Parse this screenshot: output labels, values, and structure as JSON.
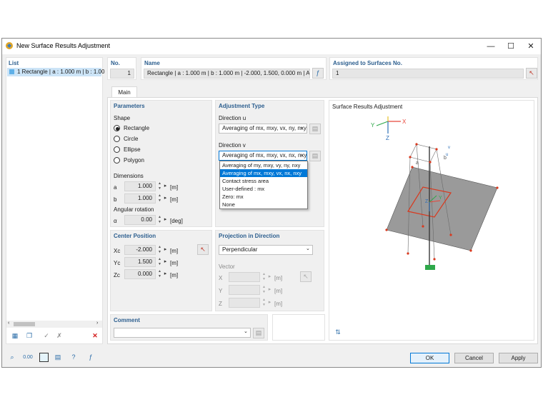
{
  "window": {
    "title": "New Surface Results Adjustment"
  },
  "list": {
    "header": "List",
    "items": [
      {
        "label": "1  Rectangle | a : 1.000 m | b : 1.00"
      }
    ]
  },
  "no": {
    "label": "No.",
    "value": "1"
  },
  "name": {
    "label": "Name",
    "value": "Rectangle | a : 1.000 m | b : 1.000 m | -2.000, 1.500, 0.000 m | Avera"
  },
  "assigned": {
    "label": "Assigned to Surfaces No.",
    "value": "1"
  },
  "tabs": {
    "main": "Main"
  },
  "parameters": {
    "header": "Parameters",
    "shape_label": "Shape",
    "shapes": [
      "Rectangle",
      "Circle",
      "Ellipse",
      "Polygon"
    ],
    "selected_shape": "Rectangle",
    "dimensions_label": "Dimensions",
    "a": {
      "label": "a",
      "value": "1.000",
      "unit": "[m]"
    },
    "b": {
      "label": "b",
      "value": "1.000",
      "unit": "[m]"
    },
    "angular_label": "Angular rotation",
    "alpha": {
      "label": "α",
      "value": "0.00",
      "unit": "[deg]"
    }
  },
  "center": {
    "header": "Center Position",
    "xc": {
      "label": "Xc",
      "value": "-2.000",
      "unit": "[m]"
    },
    "yc": {
      "label": "Yc",
      "value": "1.500",
      "unit": "[m]"
    },
    "zc": {
      "label": "Zc",
      "value": "0.000",
      "unit": "[m]"
    }
  },
  "adjustment": {
    "header": "Adjustment Type",
    "u_label": "Direction u",
    "u_value": "Averaging of mx, mxy, vx, ny, nxy",
    "v_label": "Direction v",
    "v_value": "Averaging of mx, mxy, vx, nx, nxy",
    "options": [
      "Averaging of my, mxy, vy, ny, nxy",
      "Averaging of mx, mxy, vx, nx, nxy",
      "Contact stress area",
      "User-defined : mx",
      "Zero: mx",
      "None"
    ],
    "selected_index": 1
  },
  "projection": {
    "header": "Projection in Direction",
    "value": "Perpendicular",
    "vector_label": "Vector",
    "x": {
      "label": "X",
      "unit": "[m]"
    },
    "y": {
      "label": "Y",
      "unit": "[m]"
    },
    "z": {
      "label": "Z",
      "unit": "[m]"
    }
  },
  "preview": {
    "header": "Surface Results Adjustment",
    "labels": {
      "x": "X",
      "y": "Y",
      "z": "Z",
      "a": "a",
      "b": "b",
      "u": "u",
      "v": "v"
    }
  },
  "comment": {
    "header": "Comment"
  },
  "buttons": {
    "ok": "OK",
    "cancel": "Cancel",
    "apply": "Apply"
  },
  "colors": {
    "accent": "#0078d7",
    "header": "#2d5f8f",
    "surface": "#9a9a9a",
    "rect": "#d9391e",
    "support": "#2ea84a"
  }
}
